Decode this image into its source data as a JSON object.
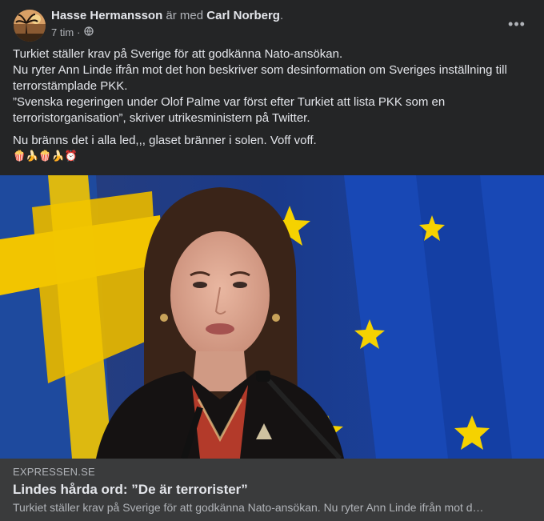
{
  "post": {
    "author": "Hasse Hermansson",
    "with_text": "är med",
    "tagged": "Carl Norberg",
    "trailing_dot": ".",
    "time": "7 tim",
    "separator": "·",
    "privacy_icon": "globe-icon",
    "more_icon": "•••"
  },
  "body": {
    "line1": "Turkiet ställer krav på Sverige för att godkänna Nato-ansökan.",
    "line2": "Nu ryter Ann Linde ifrån mot det hon beskriver som desinformation om Sveriges inställning till terrorstämplade PKK.",
    "line3": "”Svenska regeringen under Olof Palme var först efter Turkiet att lista PKK som en terroristorganisation”, skriver utrikesministern på Twitter.",
    "line4": "Nu bränns det i alla led,,, glaset bränner i solen. Voff voff.",
    "emojis": "🍿🍌🍿🍌⏰"
  },
  "link_preview": {
    "domain": "EXPRESSEN.SE",
    "title": "Lindes hårda ord: ”De är terrorister”",
    "description": "Turkiet ställer krav på Sverige för att godkänna Nato-ansökan. Nu ryter Ann Linde ifrån mot d…"
  },
  "colors": {
    "card_bg": "#242526",
    "link_bg": "#3a3b3c",
    "primary_text": "#e4e6eb",
    "secondary_text": "#b0b3b8",
    "flag_blue": "#1d3f8c",
    "flag_yellow": "#f2c500"
  }
}
